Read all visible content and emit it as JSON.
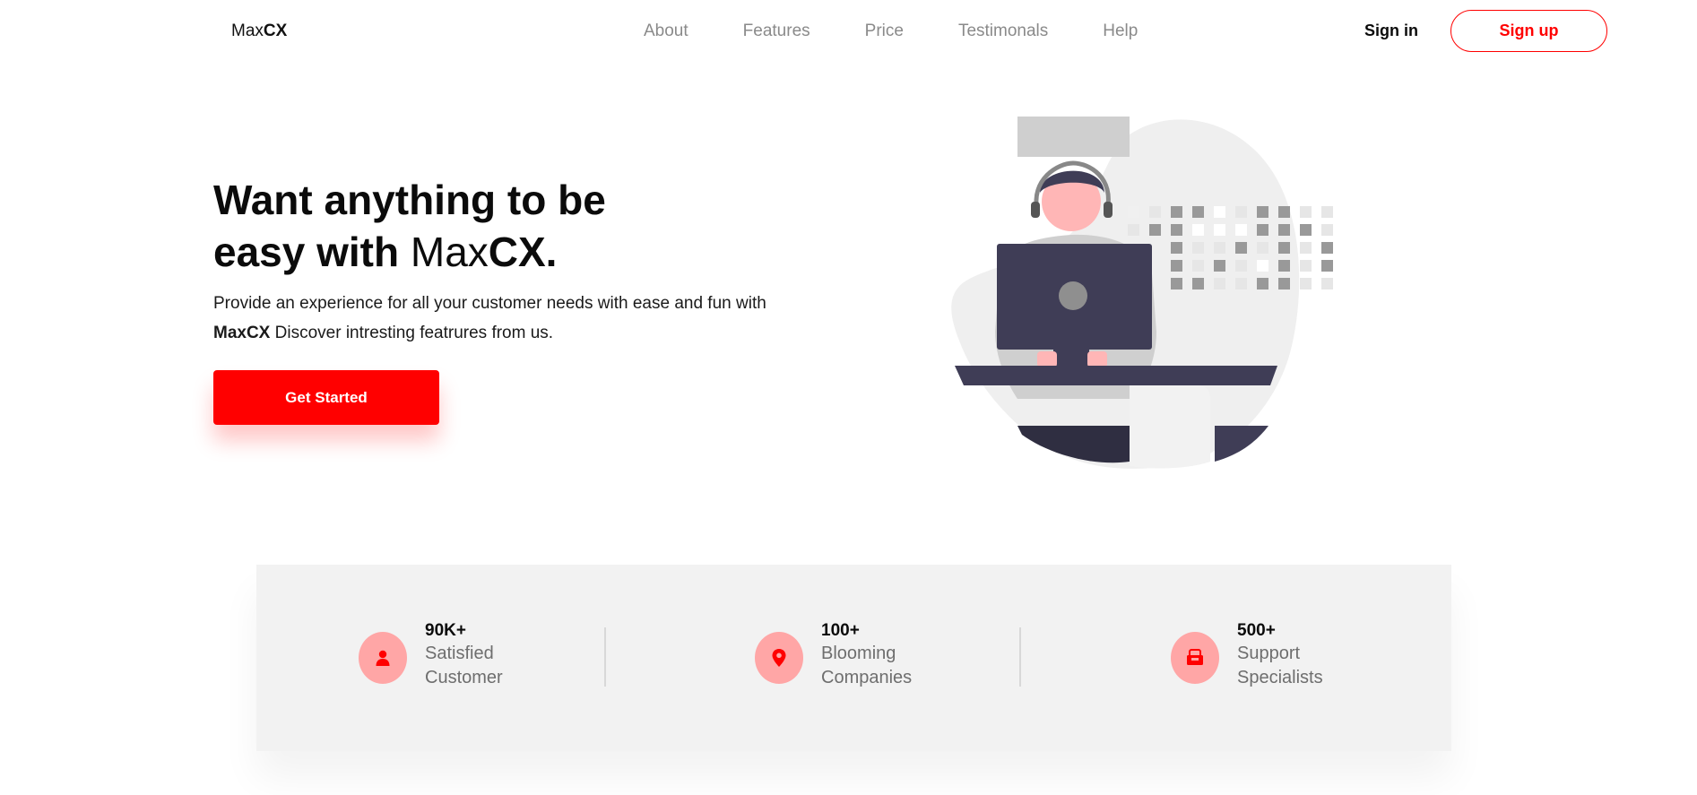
{
  "header": {
    "logo_prefix": "Max",
    "logo_bold": "CX",
    "nav": [
      "About",
      "Features",
      "Price",
      "Testimonals",
      "Help"
    ],
    "signin": "Sign in",
    "signup": "Sign up"
  },
  "hero": {
    "title_line1": "Want anything to be",
    "title_line2_prefix": "easy with ",
    "title_brand_light": "Max",
    "title_brand_bold": "CX.",
    "desc_line1": "Provide an experience for all your customer needs with ease and fun with",
    "desc_brand": "MaxCX",
    "desc_rest": " Discover intresting featrures from us.",
    "cta": "Get Started"
  },
  "stats": [
    {
      "value": "90K+",
      "label": "Satisfied Customer",
      "icon": "user-icon"
    },
    {
      "value": "100+",
      "label": "Blooming Companies",
      "icon": "location-pin-icon"
    },
    {
      "value": "500+",
      "label": "Support Specialists",
      "icon": "support-box-icon"
    }
  ],
  "colors": {
    "accent": "#ff0000",
    "icon_bg": "#ffa6a6",
    "stats_bg": "#f2f2f2",
    "nav_text": "#8a8a8a"
  }
}
